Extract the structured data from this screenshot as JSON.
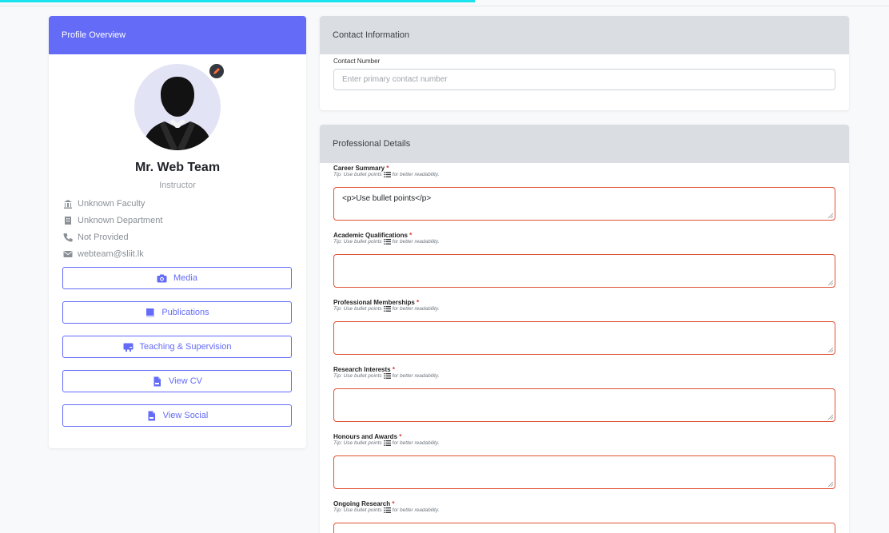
{
  "profile": {
    "header": "Profile Overview",
    "name": "Mr. Web Team",
    "role": "Instructor",
    "faculty": "Unknown Faculty",
    "department": "Unknown Department",
    "phone": "Not Provided",
    "email": "webteam@sliit.lk",
    "buttons": {
      "media": "Media",
      "publications": "Publications",
      "teaching": "Teaching & Supervision",
      "view_cv": "View CV",
      "view_social": "View Social"
    }
  },
  "contact": {
    "header": "Contact Information",
    "number_label": "Contact Number",
    "number_placeholder": "Enter primary contact number"
  },
  "professional": {
    "header": "Professional Details",
    "tip_prefix": "Tip: Use bullet points",
    "tip_suffix": "for better readability.",
    "required_mark": "*",
    "fields": [
      {
        "label": "Career Summary",
        "value": "<p>Use bullet points</p>"
      },
      {
        "label": "Academic Qualifications",
        "value": ""
      },
      {
        "label": "Professional Memberships",
        "value": ""
      },
      {
        "label": "Research Interests",
        "value": ""
      },
      {
        "label": "Honours and Awards",
        "value": ""
      },
      {
        "label": "Ongoing Research",
        "value": ""
      }
    ]
  },
  "colors": {
    "accent": "#636bf7",
    "progress": "#19e3ec",
    "error_border": "#e05233",
    "header_gray": "#dadde1"
  }
}
